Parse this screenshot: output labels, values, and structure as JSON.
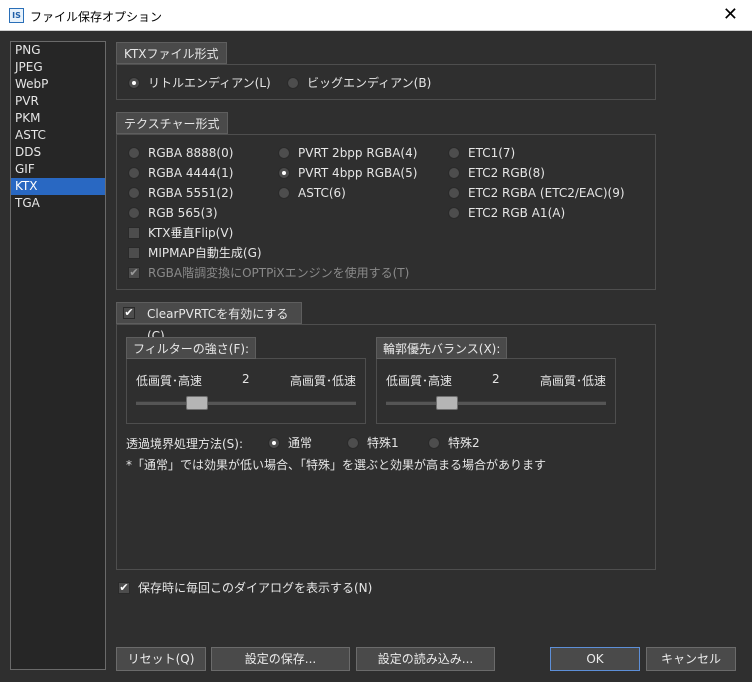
{
  "window": {
    "title": "ファイル保存オプション",
    "app_icon_text": "IS",
    "close_glyph": "✕"
  },
  "sidebar": {
    "items": [
      {
        "label": "PNG"
      },
      {
        "label": "JPEG"
      },
      {
        "label": "WebP"
      },
      {
        "label": "PVR"
      },
      {
        "label": "PKM"
      },
      {
        "label": "ASTC"
      },
      {
        "label": "DDS"
      },
      {
        "label": "GIF"
      },
      {
        "label": "KTX"
      },
      {
        "label": "TGA"
      }
    ],
    "selected": "KTX"
  },
  "ktx_format": {
    "header": "KTXファイル形式",
    "little_endian": "リトルエンディアン(L)",
    "big_endian": "ビッグエンディアン(B)",
    "selected": "little_endian"
  },
  "texture_format": {
    "header": "テクスチャー形式",
    "col1": [
      "RGBA 8888(0)",
      "RGBA 4444(1)",
      "RGBA 5551(2)",
      "RGB 565(3)"
    ],
    "col2": [
      "PVRT 2bpp RGBA(4)",
      "PVRT 4bpp RGBA(5)",
      "ASTC(6)"
    ],
    "col3": [
      "ETC1(7)",
      "ETC2 RGB(8)",
      "ETC2 RGBA (ETC2/EAC)(9)",
      "ETC2 RGB A1(A)"
    ],
    "selected": "PVRT 4bpp RGBA(5)",
    "flip_label": "KTX垂直Flip(V)",
    "mipmap_label": "MIPMAP自動生成(G)",
    "optpix_label": "RGBA階調変換にOPTPiXエンジンを使用する(T)",
    "check_glyph": "✔"
  },
  "clearpvrtc": {
    "enable_label": "ClearPVRTCを有効にする(C)",
    "filter": {
      "header": "フィルターの強さ(F):",
      "low": "低画質･高速",
      "value": "2",
      "high": "高画質･低速",
      "level": 0.25
    },
    "edge": {
      "header": "輪郭優先バランス(X):",
      "low": "低画質･高速",
      "value": "2",
      "high": "高画質･低速",
      "level": 0.25
    },
    "transparency": {
      "label": "透過境界処理方法(S):",
      "options": [
        "通常",
        "特殊1",
        "特殊2"
      ],
      "selected": "通常"
    },
    "note": "*「通常」では効果が低い場合、「特殊」を選ぶと効果が高まる場合があります"
  },
  "show_dialog_label": "保存時に毎回このダイアログを表示する(N)",
  "buttons": {
    "reset": "リセット(Q)",
    "save_settings": "設定の保存...",
    "load_settings": "設定の読み込み...",
    "ok": "OK",
    "cancel": "キャンセル"
  },
  "colors": {
    "selection": "#2968c2",
    "background": "#2f2f2f"
  }
}
